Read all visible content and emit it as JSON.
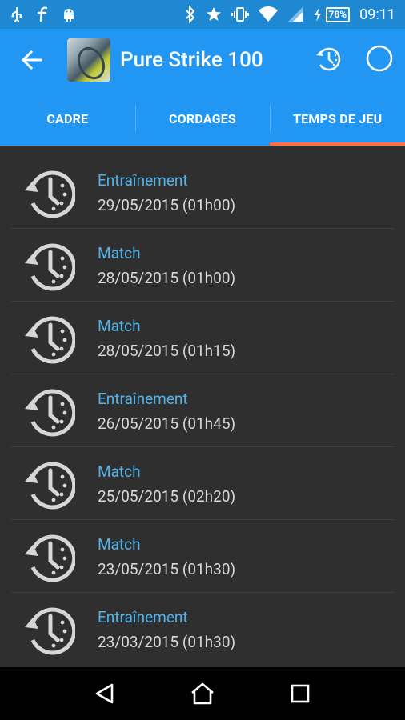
{
  "status_bar": {
    "time": "09:11",
    "battery": "78%",
    "icons": [
      "usb-icon",
      "facebook-icon",
      "android-icon",
      "bluetooth-icon",
      "star-icon",
      "vibrate-icon",
      "wifi-icon",
      "signal-icon",
      "charging-icon",
      "battery-icon"
    ]
  },
  "app_bar": {
    "title": "Pure Strike 100",
    "actions": [
      "history-icon",
      "circle-icon"
    ]
  },
  "tabs": [
    {
      "label": "CADRE",
      "active": false
    },
    {
      "label": "CORDAGES",
      "active": false
    },
    {
      "label": "TEMPS DE JEU",
      "active": true
    }
  ],
  "sessions": [
    {
      "type": "Entraînement",
      "date": "29/05/2015 (01h00)"
    },
    {
      "type": "Match",
      "date": "28/05/2015 (01h00)"
    },
    {
      "type": "Match",
      "date": "28/05/2015 (01h15)"
    },
    {
      "type": "Entraînement",
      "date": "26/05/2015 (01h45)"
    },
    {
      "type": "Match",
      "date": "25/05/2015 (02h20)"
    },
    {
      "type": "Match",
      "date": "23/05/2015 (01h30)"
    },
    {
      "type": "Entraînement",
      "date": "23/03/2015 (01h30)"
    }
  ],
  "colors": {
    "status_bar": "#1e88d3",
    "primary": "#2196f3",
    "tab_indicator": "#ff7043",
    "session_type": "#4fb3ea",
    "background": "#2f2f2f"
  },
  "nav": [
    "back-nav-icon",
    "home-nav-icon",
    "recents-nav-icon"
  ]
}
